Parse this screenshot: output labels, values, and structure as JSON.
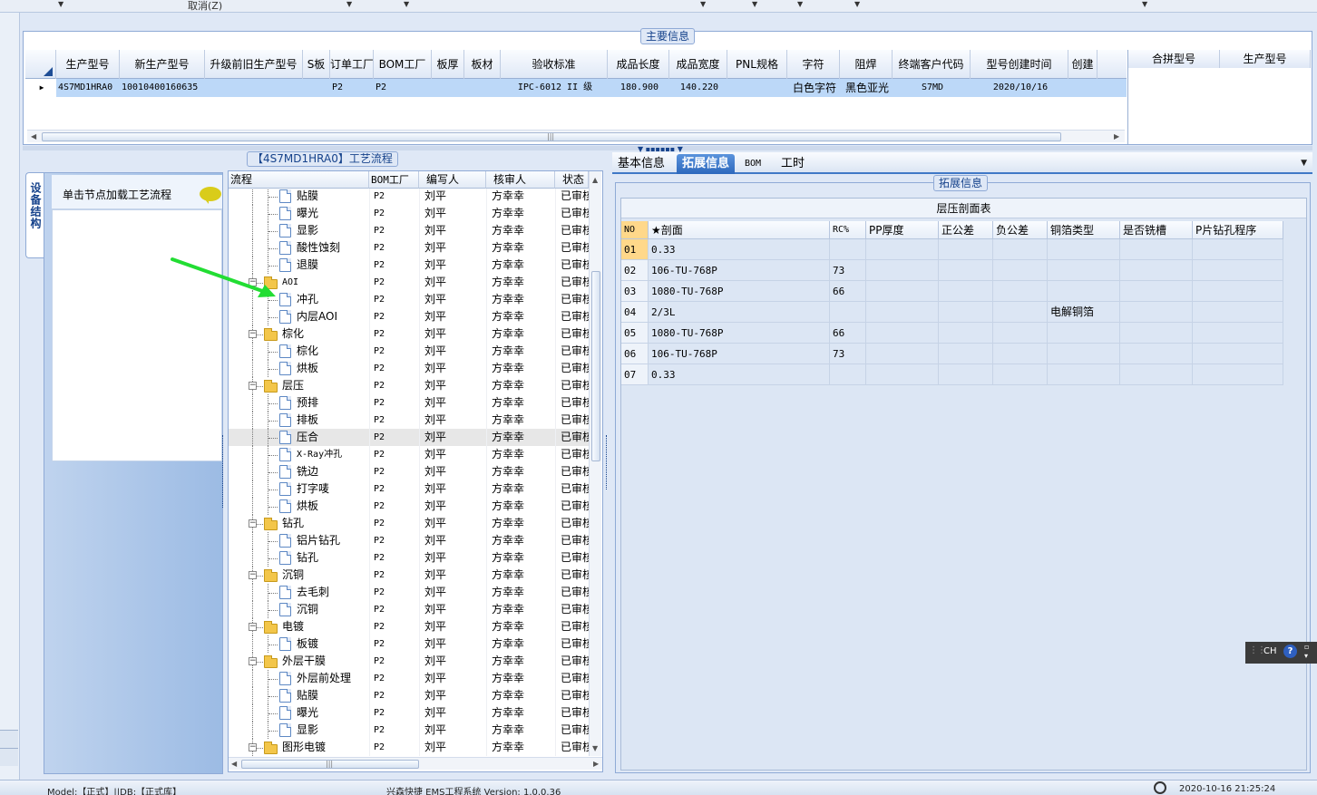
{
  "toolbar": {
    "cancel_label": "取消(Z)"
  },
  "main_info": {
    "legend": "主要信息",
    "columns": [
      "生产型号",
      "新生产型号",
      "升级前旧生产型号",
      "S板",
      "订单工厂",
      "BOM工厂",
      "板厚",
      "板材",
      "验收标准",
      "成品长度",
      "成品宽度",
      "PNL规格",
      "字符",
      "阻焊",
      "终端客户代码",
      "型号创建时间",
      "创建"
    ],
    "row": [
      "4S7MD1HRA0",
      "10010400160635",
      "",
      "",
      "P2",
      "P2",
      "",
      "",
      "IPC-6012 II 级",
      "180.900",
      "140.220",
      "",
      "白色字符",
      "黑色亚光",
      "S7MD",
      "2020/10/16",
      ""
    ],
    "side_columns": [
      "合拼型号",
      "生产型号"
    ]
  },
  "process": {
    "legend": "【4S7MD1HRA0】工艺流程",
    "columns": [
      "流程",
      "BOM工厂",
      "编写人",
      "核审人",
      "状态"
    ],
    "rows": [
      {
        "name": "贴膜",
        "type": "leaf",
        "factory": "P2",
        "writer": "刘平",
        "reviewer": "方幸幸",
        "status": "已审核"
      },
      {
        "name": "曝光",
        "type": "leaf",
        "factory": "P2",
        "writer": "刘平",
        "reviewer": "方幸幸",
        "status": "已审核"
      },
      {
        "name": "显影",
        "type": "leaf",
        "factory": "P2",
        "writer": "刘平",
        "reviewer": "方幸幸",
        "status": "已审核"
      },
      {
        "name": "酸性蚀刻",
        "type": "leaf",
        "factory": "P2",
        "writer": "刘平",
        "reviewer": "方幸幸",
        "status": "已审核"
      },
      {
        "name": "退膜",
        "type": "leaf",
        "factory": "P2",
        "writer": "刘平",
        "reviewer": "方幸幸",
        "status": "已审核"
      },
      {
        "name": "AOI",
        "type": "folder",
        "factory": "P2",
        "writer": "刘平",
        "reviewer": "方幸幸",
        "status": "已审核"
      },
      {
        "name": "冲孔",
        "type": "leaf",
        "factory": "P2",
        "writer": "刘平",
        "reviewer": "方幸幸",
        "status": "已审核"
      },
      {
        "name": "内层AOI",
        "type": "leaf",
        "factory": "P2",
        "writer": "刘平",
        "reviewer": "方幸幸",
        "status": "已审核"
      },
      {
        "name": "棕化",
        "type": "folder",
        "factory": "P2",
        "writer": "刘平",
        "reviewer": "方幸幸",
        "status": "已审核"
      },
      {
        "name": "棕化",
        "type": "leaf",
        "factory": "P2",
        "writer": "刘平",
        "reviewer": "方幸幸",
        "status": "已审核"
      },
      {
        "name": "烘板",
        "type": "leaf",
        "factory": "P2",
        "writer": "刘平",
        "reviewer": "方幸幸",
        "status": "已审核"
      },
      {
        "name": "层压",
        "type": "folder",
        "factory": "P2",
        "writer": "刘平",
        "reviewer": "方幸幸",
        "status": "已审核"
      },
      {
        "name": "预排",
        "type": "leaf",
        "factory": "P2",
        "writer": "刘平",
        "reviewer": "方幸幸",
        "status": "已审核"
      },
      {
        "name": "排板",
        "type": "leaf",
        "factory": "P2",
        "writer": "刘平",
        "reviewer": "方幸幸",
        "status": "已审核"
      },
      {
        "name": "压合",
        "type": "leaf",
        "factory": "P2",
        "writer": "刘平",
        "reviewer": "方幸幸",
        "status": "已审核",
        "selected": true
      },
      {
        "name": "X-Ray冲孔",
        "type": "leaf",
        "factory": "P2",
        "writer": "刘平",
        "reviewer": "方幸幸",
        "status": "已审核"
      },
      {
        "name": "铣边",
        "type": "leaf",
        "factory": "P2",
        "writer": "刘平",
        "reviewer": "方幸幸",
        "status": "已审核"
      },
      {
        "name": "打字唛",
        "type": "leaf",
        "factory": "P2",
        "writer": "刘平",
        "reviewer": "方幸幸",
        "status": "已审核"
      },
      {
        "name": "烘板",
        "type": "leaf",
        "factory": "P2",
        "writer": "刘平",
        "reviewer": "方幸幸",
        "status": "已审核"
      },
      {
        "name": "钻孔",
        "type": "folder",
        "factory": "P2",
        "writer": "刘平",
        "reviewer": "方幸幸",
        "status": "已审核"
      },
      {
        "name": "铝片钻孔",
        "type": "leaf",
        "factory": "P2",
        "writer": "刘平",
        "reviewer": "方幸幸",
        "status": "已审核"
      },
      {
        "name": "钻孔",
        "type": "leaf",
        "factory": "P2",
        "writer": "刘平",
        "reviewer": "方幸幸",
        "status": "已审核"
      },
      {
        "name": "沉铜",
        "type": "folder",
        "factory": "P2",
        "writer": "刘平",
        "reviewer": "方幸幸",
        "status": "已审核"
      },
      {
        "name": "去毛刺",
        "type": "leaf",
        "factory": "P2",
        "writer": "刘平",
        "reviewer": "方幸幸",
        "status": "已审核"
      },
      {
        "name": "沉铜",
        "type": "leaf",
        "factory": "P2",
        "writer": "刘平",
        "reviewer": "方幸幸",
        "status": "已审核"
      },
      {
        "name": "电镀",
        "type": "folder",
        "factory": "P2",
        "writer": "刘平",
        "reviewer": "方幸幸",
        "status": "已审核"
      },
      {
        "name": "板镀",
        "type": "leaf",
        "factory": "P2",
        "writer": "刘平",
        "reviewer": "方幸幸",
        "status": "已审核"
      },
      {
        "name": "外层干膜",
        "type": "folder",
        "factory": "P2",
        "writer": "刘平",
        "reviewer": "方幸幸",
        "status": "已审核"
      },
      {
        "name": "外层前处理",
        "type": "leaf",
        "factory": "P2",
        "writer": "刘平",
        "reviewer": "方幸幸",
        "status": "已审核"
      },
      {
        "name": "贴膜",
        "type": "leaf",
        "factory": "P2",
        "writer": "刘平",
        "reviewer": "方幸幸",
        "status": "已审核"
      },
      {
        "name": "曝光",
        "type": "leaf",
        "factory": "P2",
        "writer": "刘平",
        "reviewer": "方幸幸",
        "status": "已审核"
      },
      {
        "name": "显影",
        "type": "leaf",
        "factory": "P2",
        "writer": "刘平",
        "reviewer": "方幸幸",
        "status": "已审核"
      },
      {
        "name": "图形电镀",
        "type": "folder",
        "factory": "P2",
        "writer": "刘平",
        "reviewer": "方幸幸",
        "status": "已审核"
      }
    ]
  },
  "left_panel": {
    "vertical_tab": "设备结构",
    "hint": "单击节点加载工艺流程"
  },
  "tabs": [
    "基本信息",
    "拓展信息",
    "BOM",
    "工时"
  ],
  "active_tab": 1,
  "ext_info": {
    "legend": "拓展信息",
    "table_title": "层压剖面表",
    "columns": [
      "NO",
      "★剖面",
      "RC%",
      "PP厚度",
      "正公差",
      "负公差",
      "铜箔类型",
      "是否铣槽",
      "P片钻孔程序"
    ],
    "rows": [
      [
        "01",
        "0.33",
        "",
        "",
        "",
        "",
        "",
        "",
        ""
      ],
      [
        "02",
        "106-TU-768P",
        "73",
        "",
        "",
        "",
        "",
        "",
        ""
      ],
      [
        "03",
        "1080-TU-768P",
        "66",
        "",
        "",
        "",
        "",
        "",
        ""
      ],
      [
        "04",
        "2/3L",
        "",
        "",
        "",
        "",
        "电解铜箔",
        "",
        ""
      ],
      [
        "05",
        "1080-TU-768P",
        "66",
        "",
        "",
        "",
        "",
        "",
        ""
      ],
      [
        "06",
        "106-TU-768P",
        "73",
        "",
        "",
        "",
        "",
        "",
        ""
      ],
      [
        "07",
        "0.33",
        "",
        "",
        "",
        "",
        "",
        "",
        ""
      ]
    ]
  },
  "lang_bar": {
    "lang": "CH",
    "help": "?"
  },
  "status": {
    "model": "Model:【正式】||DB:【正式库】",
    "system": "兴森快捷 EMS工程系统 Version: 1.0.0.36",
    "datetime": "2020-10-16 21:25:24"
  },
  "colors": {
    "accent": "#2d68bd",
    "selection": "#bcd8f8",
    "annotation_arrow": "#22dd33"
  }
}
